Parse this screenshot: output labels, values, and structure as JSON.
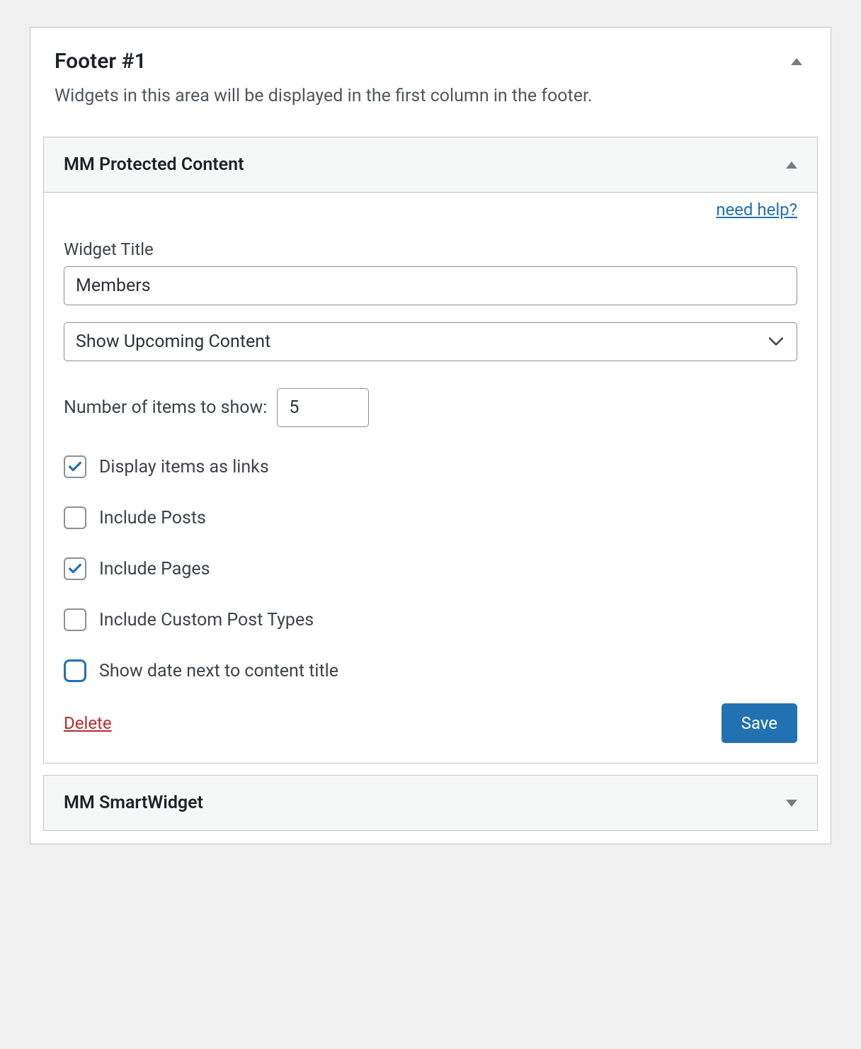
{
  "panel": {
    "title": "Footer #1",
    "description": "Widgets in this area will be displayed in the first column in the footer."
  },
  "widget1": {
    "title": "MM Protected Content",
    "help_link": "need help?",
    "widget_title_label": "Widget Title",
    "widget_title_value": "Members",
    "select_value": "Show Upcoming Content",
    "num_items_label": "Number of items to show:",
    "num_items_value": "5",
    "checks": {
      "links": {
        "label": "Display items as links",
        "checked": true
      },
      "posts": {
        "label": "Include Posts",
        "checked": false
      },
      "pages": {
        "label": "Include Pages",
        "checked": true
      },
      "cpt": {
        "label": "Include Custom Post Types",
        "checked": false
      },
      "date": {
        "label": "Show date next to content title",
        "checked": false,
        "focused": true
      }
    },
    "delete_label": "Delete",
    "save_label": "Save"
  },
  "widget2": {
    "title": "MM SmartWidget"
  }
}
